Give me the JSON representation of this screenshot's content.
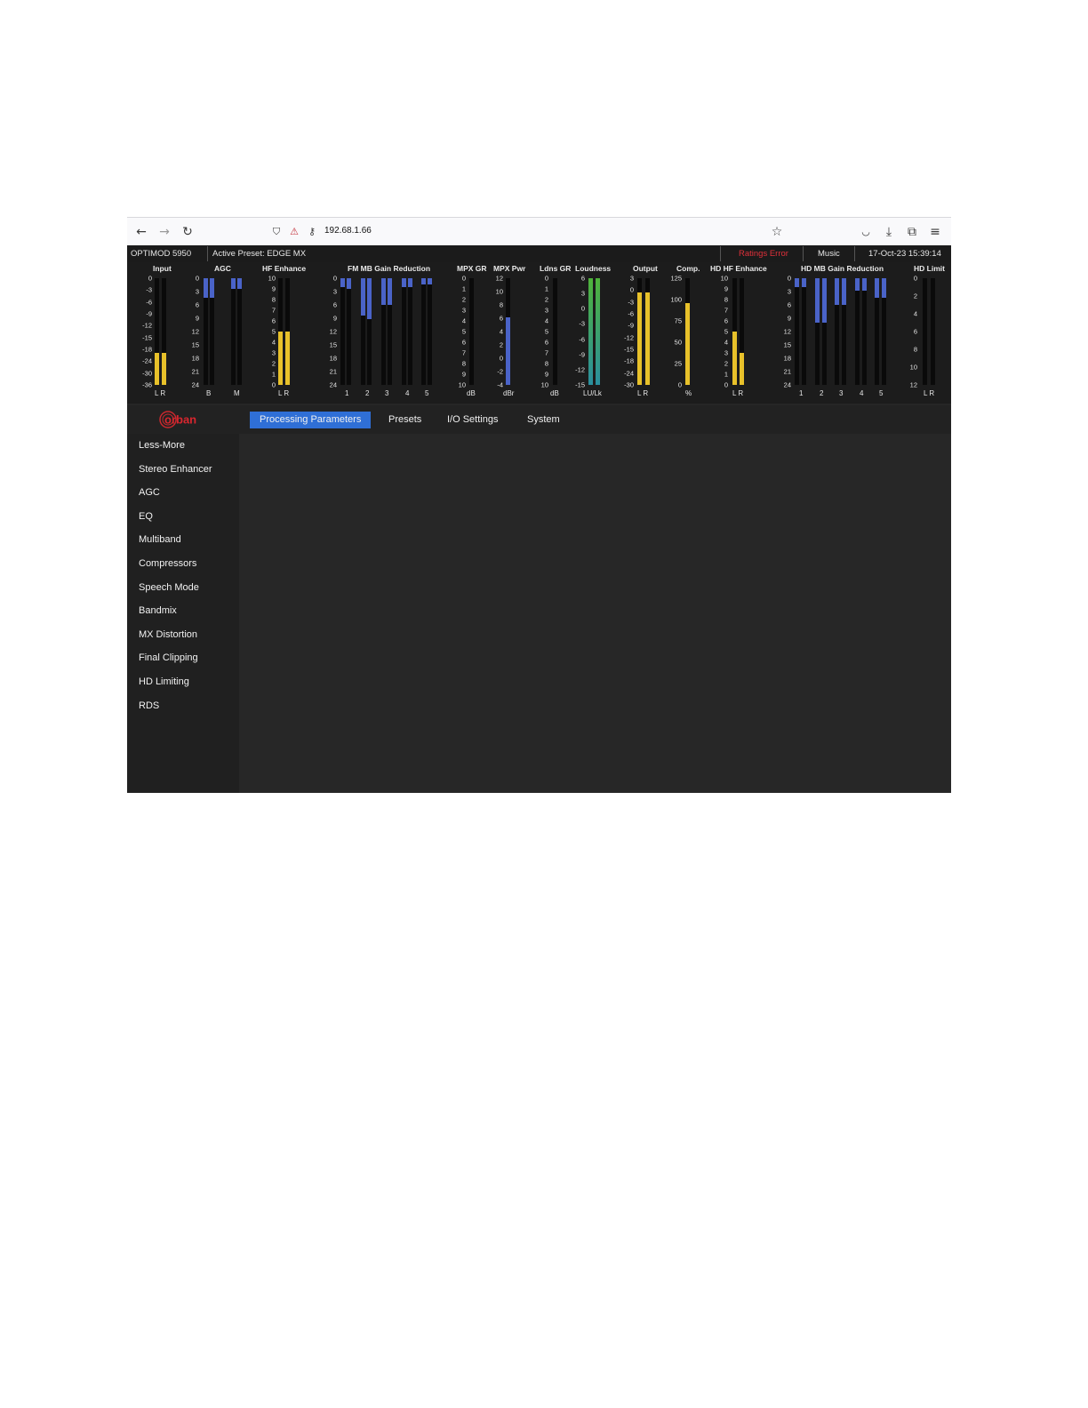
{
  "browser": {
    "url": "192.68.1.66",
    "icons": [
      "back-arrow-icon",
      "forward-arrow-icon",
      "reload-icon",
      "shield-icon",
      "lock-icon",
      "key-icon",
      "star-icon",
      "pocket-icon",
      "download-icon",
      "extensions-icon",
      "menu-icon"
    ]
  },
  "status": {
    "device": "OPTIMOD 5950",
    "preset": "Active Preset: EDGE MX",
    "ratings": "Ratings Error",
    "ratings_color": "#e0303a",
    "mode": "Music",
    "datetime": "17-Oct-23 15:39:14"
  },
  "meters": {
    "input": {
      "title": "Input",
      "scale": [
        "0",
        "-3",
        "-6",
        "-9",
        "-12",
        "-15",
        "-18",
        "-24",
        "-30",
        "-36"
      ],
      "foot": "L R",
      "levels": [
        0.3,
        0.3
      ]
    },
    "agc": {
      "title": "AGC",
      "scale": [
        "0",
        "3",
        "6",
        "9",
        "12",
        "15",
        "18",
        "21",
        "24"
      ],
      "foot_b": "B",
      "foot_m": "M",
      "levels": [
        0.18,
        0.18,
        0.1,
        0.1
      ]
    },
    "hf_enhance": {
      "title": "HF Enhance",
      "scale": [
        "10",
        "9",
        "8",
        "7",
        "6",
        "5",
        "4",
        "3",
        "2",
        "1",
        "0"
      ],
      "foot": "L R",
      "levels": [
        0.5,
        0.5
      ]
    },
    "fm_mb_gr": {
      "title": "FM MB Gain Reduction",
      "scale": [
        "0",
        "3",
        "6",
        "9",
        "12",
        "15",
        "18",
        "21",
        "24"
      ],
      "foot": [
        "1",
        "2",
        "3",
        "4",
        "5"
      ],
      "levels": [
        0.08,
        0.1,
        0.35,
        0.38,
        0.25,
        0.25,
        0.08,
        0.08,
        0.06,
        0.06
      ]
    },
    "mpx_gr": {
      "title": "MPX GR",
      "scale": [
        "0",
        "1",
        "2",
        "3",
        "4",
        "5",
        "6",
        "7",
        "8",
        "9",
        "10"
      ],
      "foot": "dB",
      "levels": [
        0
      ]
    },
    "mpx_pwr": {
      "title": "MPX Pwr",
      "scale": [
        "12",
        "10",
        "8",
        "6",
        "4",
        "2",
        "0",
        "-2",
        "-4"
      ],
      "foot": "dBr",
      "levels": [
        0.63
      ]
    },
    "ldns_gr": {
      "title": "Ldns GR",
      "scale": [
        "0",
        "1",
        "2",
        "3",
        "4",
        "5",
        "6",
        "7",
        "8",
        "9",
        "10"
      ],
      "foot": "dB",
      "levels": [
        0
      ]
    },
    "loudness": {
      "title": "Loudness",
      "scale": [
        "6",
        "3",
        "0",
        "-3",
        "-6",
        "-9",
        "-12",
        "-15"
      ],
      "foot": "LU/Lk",
      "levels": [
        1.0,
        1.0
      ]
    },
    "output": {
      "title": "Output",
      "scale": [
        "3",
        "0",
        "-3",
        "-6",
        "-9",
        "-12",
        "-15",
        "-18",
        "-24",
        "-30"
      ],
      "foot": "L R",
      "levels": [
        0.87,
        0.87
      ]
    },
    "comp": {
      "title": "Comp.",
      "scale": [
        "125",
        "100",
        "75",
        "50",
        "25",
        "0"
      ],
      "foot": "%",
      "levels": [
        0.77
      ]
    },
    "hd_hf_enhance": {
      "title": "HD HF Enhance",
      "scale": [
        "10",
        "9",
        "8",
        "7",
        "6",
        "5",
        "4",
        "3",
        "2",
        "1",
        "0"
      ],
      "foot": "L R",
      "levels": [
        0.5,
        0.3
      ]
    },
    "hd_mb_gr": {
      "title": "HD MB Gain Reduction",
      "scale": [
        "0",
        "3",
        "6",
        "9",
        "12",
        "15",
        "18",
        "21",
        "24"
      ],
      "foot": [
        "1",
        "2",
        "3",
        "4",
        "5"
      ],
      "levels": [
        0.08,
        0.08,
        0.42,
        0.42,
        0.25,
        0.25,
        0.12,
        0.12,
        0.18,
        0.18
      ]
    },
    "hd_limit": {
      "title": "HD Limit",
      "scale": [
        "0",
        "2",
        "4",
        "6",
        "8",
        "10",
        "12"
      ],
      "foot": "L R",
      "levels": [
        0,
        0
      ]
    },
    "colors": {
      "yellow": "#e8c12a",
      "blue": "#4a63c8",
      "green": "#4fb33a",
      "teal": "#2a8f9e"
    }
  },
  "nav": {
    "logo": "orban",
    "tabs": [
      "Processing Parameters",
      "Presets",
      "I/O Settings",
      "System"
    ]
  },
  "sidebar": [
    "Less-More",
    "Stereo Enhancer",
    "AGC",
    "EQ",
    "Multiband",
    "Compressors",
    "Speech Mode",
    "Bandmix",
    "MX Distortion",
    "Final Clipping",
    "HD Limiting",
    "RDS"
  ]
}
